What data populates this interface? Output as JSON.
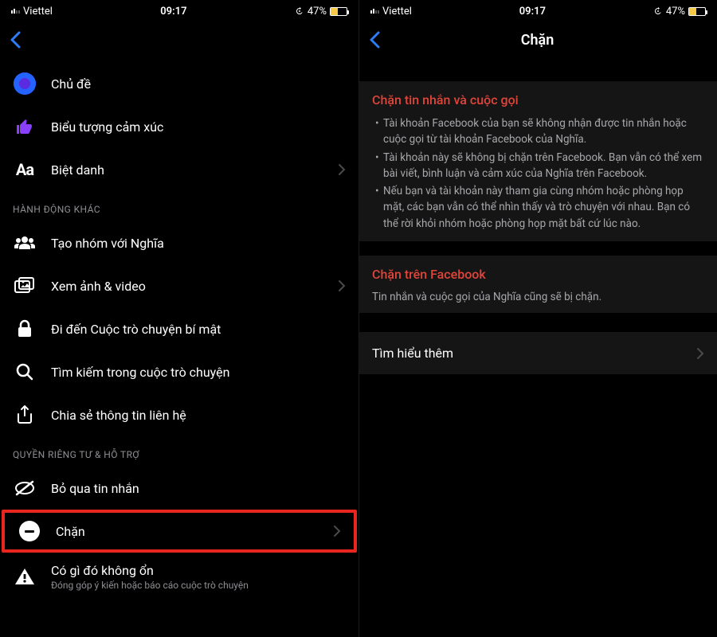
{
  "status": {
    "carrier": "Viettel",
    "time": "09:17",
    "battery_pct": "47%"
  },
  "left": {
    "title": "",
    "rows": {
      "theme": "Chủ đề",
      "emoji": "Biểu tượng cảm xúc",
      "nickname": "Biệt danh"
    },
    "section_actions": "HÀNH ĐỘNG KHÁC",
    "actions": {
      "create_group": "Tạo nhóm với Nghĩa",
      "view_media": "Xem ảnh & video",
      "secret_conv": "Đi đến Cuộc trò chuyện bí mật",
      "search_conv": "Tìm kiếm trong cuộc trò chuyện",
      "share_contact": "Chia sẻ thông tin liên hệ"
    },
    "section_privacy": "QUYỀN RIÊNG TƯ & HỖ TRỢ",
    "privacy": {
      "ignore": "Bỏ qua tin nhắn",
      "block": "Chặn",
      "report": "Có gì đó không ổn",
      "report_sub": "Đóng góp ý kiến hoặc báo cáo cuộc trò chuyện"
    }
  },
  "right": {
    "title": "Chặn",
    "block1_title": "Chặn tin nhắn và cuộc gọi",
    "block1_items": [
      "Tài khoản Facebook của bạn sẽ không nhận được tin nhắn hoặc cuộc gọi từ tài khoản Facebook của Nghĩa.",
      "Tài khoản này sẽ không bị chặn trên Facebook. Bạn vẫn có thể xem bài viết, bình luận và cảm xúc của Nghĩa trên Facebook.",
      "Nếu bạn và tài khoản này tham gia cùng nhóm hoặc phòng họp mặt, các bạn vẫn có thể nhìn thấy và trò chuyện với nhau. Bạn có thể rời khỏi nhóm hoặc phòng họp mặt bất cứ lúc nào."
    ],
    "block2_title": "Chặn trên Facebook",
    "block2_text": "Tin nhắn và cuộc gọi của Nghĩa cũng sẽ bị chặn.",
    "learn_more": "Tìm hiểu thêm"
  }
}
